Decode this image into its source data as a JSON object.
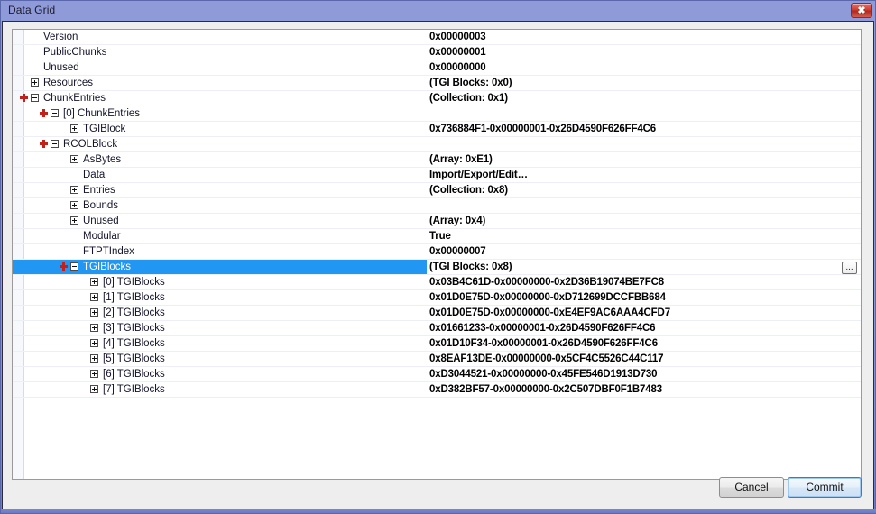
{
  "window": {
    "title": "Data Grid",
    "close_label": "✖"
  },
  "grid": {
    "editor_button_label": "...",
    "rows": [
      {
        "label": "Version",
        "value": "0x00000003",
        "depth": 0,
        "expander": "none",
        "add": false,
        "selected": false
      },
      {
        "label": "PublicChunks",
        "value": "0x00000001",
        "depth": 0,
        "expander": "none",
        "add": false,
        "selected": false
      },
      {
        "label": "Unused",
        "value": "0x00000000",
        "depth": 0,
        "expander": "none",
        "add": false,
        "selected": false
      },
      {
        "label": "Resources",
        "value": "(TGI Blocks: 0x0)",
        "depth": 0,
        "expander": "plus",
        "add": false,
        "selected": false
      },
      {
        "label": "ChunkEntries",
        "value": "(Collection: 0x1)",
        "depth": 0,
        "expander": "minus",
        "add": true,
        "selected": false
      },
      {
        "label": "[0] ChunkEntries",
        "value": "",
        "depth": 1,
        "expander": "minus",
        "add": true,
        "selected": false
      },
      {
        "label": "TGIBlock",
        "value": "0x736884F1-0x00000001-0x26D4590F626FF4C6",
        "depth": 2,
        "expander": "plus",
        "add": false,
        "selected": false
      },
      {
        "label": "RCOLBlock",
        "value": "",
        "depth": 1,
        "expander": "minus",
        "add": true,
        "selected": false
      },
      {
        "label": "AsBytes",
        "value": "(Array: 0xE1)",
        "depth": 2,
        "expander": "plus",
        "add": false,
        "selected": false
      },
      {
        "label": "Data",
        "value": "Import/Export/Edit…",
        "depth": 2,
        "expander": "none",
        "add": false,
        "selected": false
      },
      {
        "label": "Entries",
        "value": "(Collection: 0x8)",
        "depth": 2,
        "expander": "plus",
        "add": false,
        "selected": false
      },
      {
        "label": "Bounds",
        "value": "",
        "depth": 2,
        "expander": "plus",
        "add": false,
        "selected": false
      },
      {
        "label": "Unused",
        "value": "(Array: 0x4)",
        "depth": 2,
        "expander": "plus",
        "add": false,
        "selected": false
      },
      {
        "label": "Modular",
        "value": "True",
        "depth": 2,
        "expander": "none",
        "add": false,
        "selected": false
      },
      {
        "label": "FTPTIndex",
        "value": "0x00000007",
        "depth": 2,
        "expander": "none",
        "add": false,
        "selected": false
      },
      {
        "label": "TGIBlocks",
        "value": "(TGI Blocks: 0x8)",
        "depth": 2,
        "expander": "minus",
        "add": true,
        "selected": true
      },
      {
        "label": "[0] TGIBlocks",
        "value": "0x03B4C61D-0x00000000-0x2D36B19074BE7FC8",
        "depth": 3,
        "expander": "plus",
        "add": false,
        "selected": false
      },
      {
        "label": "[1] TGIBlocks",
        "value": "0x01D0E75D-0x00000000-0xD712699DCCFBB684",
        "depth": 3,
        "expander": "plus",
        "add": false,
        "selected": false
      },
      {
        "label": "[2] TGIBlocks",
        "value": "0x01D0E75D-0x00000000-0xE4EF9AC6AAA4CFD7",
        "depth": 3,
        "expander": "plus",
        "add": false,
        "selected": false
      },
      {
        "label": "[3] TGIBlocks",
        "value": "0x01661233-0x00000001-0x26D4590F626FF4C6",
        "depth": 3,
        "expander": "plus",
        "add": false,
        "selected": false
      },
      {
        "label": "[4] TGIBlocks",
        "value": "0x01D10F34-0x00000001-0x26D4590F626FF4C6",
        "depth": 3,
        "expander": "plus",
        "add": false,
        "selected": false
      },
      {
        "label": "[5] TGIBlocks",
        "value": "0x8EAF13DE-0x00000000-0x5CF4C5526C44C117",
        "depth": 3,
        "expander": "plus",
        "add": false,
        "selected": false
      },
      {
        "label": "[6] TGIBlocks",
        "value": "0xD3044521-0x00000000-0x45FE546D1913D730",
        "depth": 3,
        "expander": "plus",
        "add": false,
        "selected": false
      },
      {
        "label": "[7] TGIBlocks",
        "value": "0xD382BF57-0x00000000-0x2C507DBF0F1B7483",
        "depth": 3,
        "expander": "plus",
        "add": false,
        "selected": false
      }
    ]
  },
  "footer": {
    "cancel_label": "Cancel",
    "commit_label": "Commit"
  },
  "colors": {
    "selection": "#2196f3",
    "add_icon": "#c1201b",
    "titlebar": "#8f9ad8",
    "commit_focus": "#2f7fd1"
  }
}
